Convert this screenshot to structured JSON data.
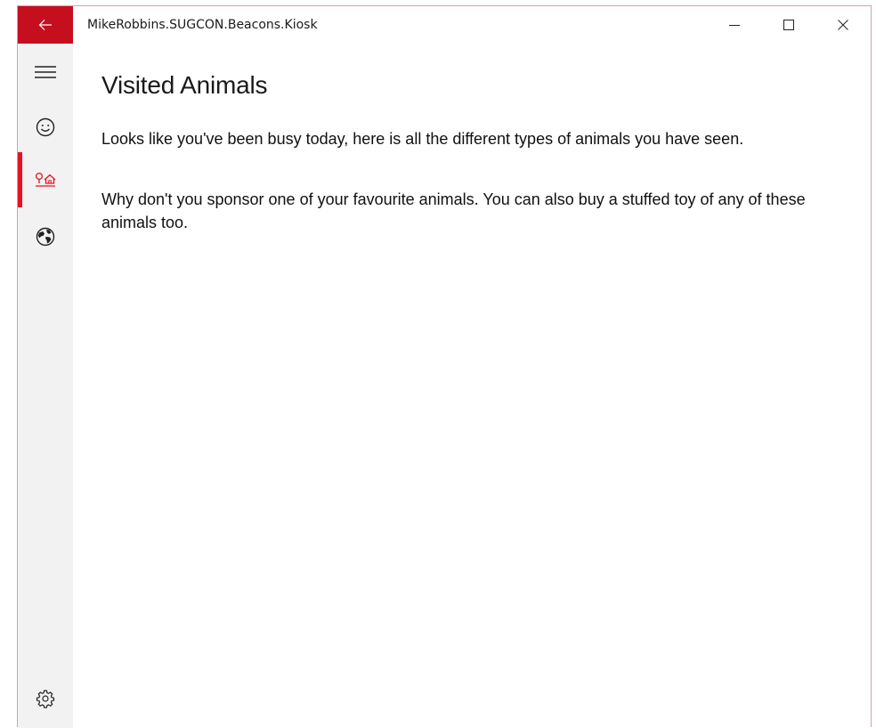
{
  "window": {
    "title": "MikeRobbins.SUGCON.Beacons.Kiosk",
    "accent_color": "#c50f1f",
    "selection_color": "#e81123"
  },
  "nav": {
    "items": [
      {
        "icon": "hamburger-icon"
      },
      {
        "icon": "smiley-icon"
      },
      {
        "icon": "zoo-icon",
        "selected": true
      },
      {
        "icon": "globe-icon"
      },
      {
        "icon": "gear-icon"
      }
    ]
  },
  "page": {
    "title": "Visited Animals",
    "paragraph1": "Looks like you've been busy today, here is all the different types of animals you have seen.",
    "paragraph2": "Why don't you sponsor one of your favourite animals. You can also buy a stuffed toy of any of these animals too."
  }
}
